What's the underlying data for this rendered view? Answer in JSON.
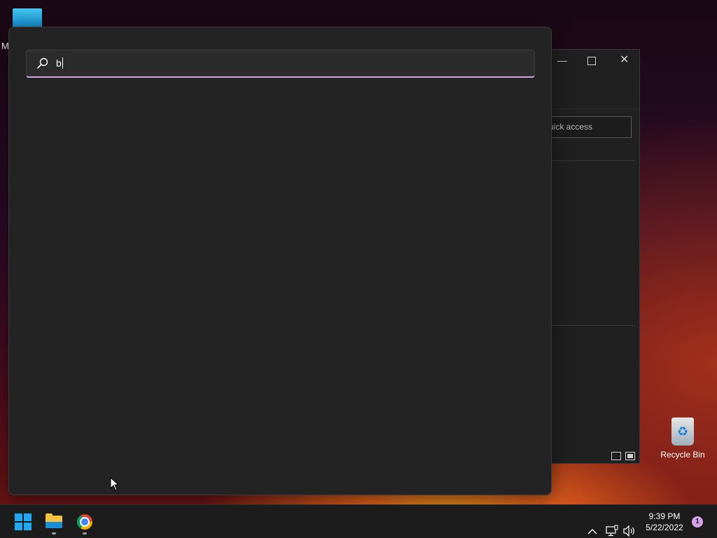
{
  "desktop": {
    "partial_label": "M",
    "recycle_bin_label": "Recycle Bin"
  },
  "background_window": {
    "search_placeholder_partial": "uick access"
  },
  "search": {
    "query": "b",
    "accent_color": "#d9a6e4"
  },
  "taskbar": {
    "time": "9:39 PM",
    "date": "5/22/2022",
    "notification_count": "1",
    "apps": [
      "start-icon",
      "file-explorer-icon",
      "chrome-icon"
    ]
  }
}
